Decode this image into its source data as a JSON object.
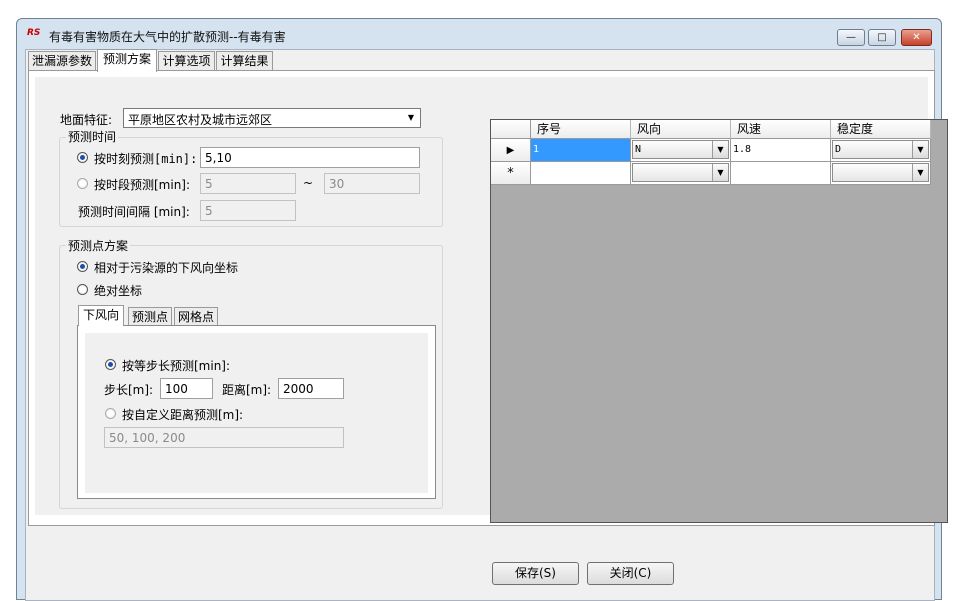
{
  "window": {
    "title": "有毒有害物质在大气中的扩散预测--有毒有害",
    "app_icon": "RS"
  },
  "tabs": [
    {
      "label": "泄漏源参数",
      "active": false
    },
    {
      "label": "预测方案",
      "active": true
    },
    {
      "label": "计算选项",
      "active": false
    },
    {
      "label": "计算结果",
      "active": false
    }
  ],
  "terrain": {
    "label": "地面特征:",
    "value": "平原地区农村及城市远郊区"
  },
  "time_group": {
    "title": "预测时间",
    "by_moment": {
      "label": "按时刻预测[min]:",
      "value": "5,10",
      "selected": true
    },
    "by_period": {
      "label": "按时段预测[min]:",
      "from": "5",
      "tilde": "~",
      "to": "30",
      "selected": false
    },
    "interval": {
      "label": "预测时间间隔 [min]:",
      "value": "5"
    }
  },
  "point_group": {
    "title": "预测点方案",
    "relative": {
      "label": "相对于污染源的下风向坐标",
      "selected": true
    },
    "absolute": {
      "label": "绝对坐标",
      "selected": false
    },
    "subtabs": [
      {
        "label": "下风向",
        "active": true
      },
      {
        "label": "预测点",
        "active": false
      },
      {
        "label": "网格点",
        "active": false
      }
    ],
    "equal_step": {
      "label": "按等步长预测[min]:",
      "selected": true
    },
    "step_label": "步长[m]:",
    "step_value": "100",
    "distance_label": "距离[m]:",
    "distance_value": "2000",
    "custom": {
      "label": "按自定义距离预测[m]:",
      "selected": false,
      "value": "50, 100, 200"
    }
  },
  "grid": {
    "columns": [
      "序号",
      "风向",
      "风速",
      "稳定度"
    ],
    "rows": [
      {
        "marker": "▶",
        "seq": "1",
        "direction": "N",
        "speed": "1.8",
        "stability": "D"
      },
      {
        "marker": "*",
        "seq": "",
        "direction": "",
        "speed": "",
        "stability": ""
      }
    ]
  },
  "buttons": {
    "save": "保存(S)",
    "close": "关闭(C)"
  },
  "icons": {
    "dropdown": "▼",
    "minimize": "—",
    "maximize": "□",
    "close": "✕"
  }
}
